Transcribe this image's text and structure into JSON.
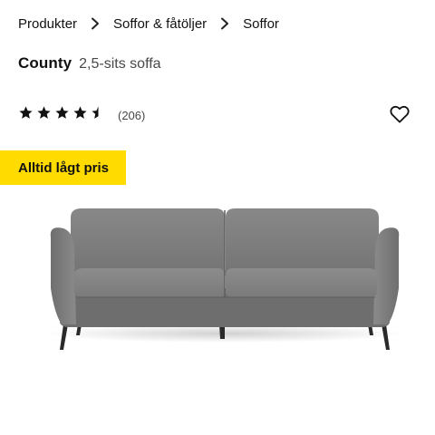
{
  "breadcrumb": {
    "items": [
      "Produkter",
      "Soffor & fåtöljer",
      "Soffor"
    ],
    "separator_icon": "chevron-right-icon"
  },
  "product": {
    "name": "County",
    "description": "2,5-sits soffa"
  },
  "rating": {
    "stars": 4.5,
    "max_stars": 5,
    "review_count": "(206)"
  },
  "favorite": {
    "icon": "heart-outline-icon"
  },
  "badge": {
    "label": "Alltid lågt pris",
    "background_color": "#ffdb00"
  },
  "image": {
    "subject": "sofa-image",
    "fabric_color": "#7d7d7d",
    "leg_color": "#2a2a2a"
  }
}
